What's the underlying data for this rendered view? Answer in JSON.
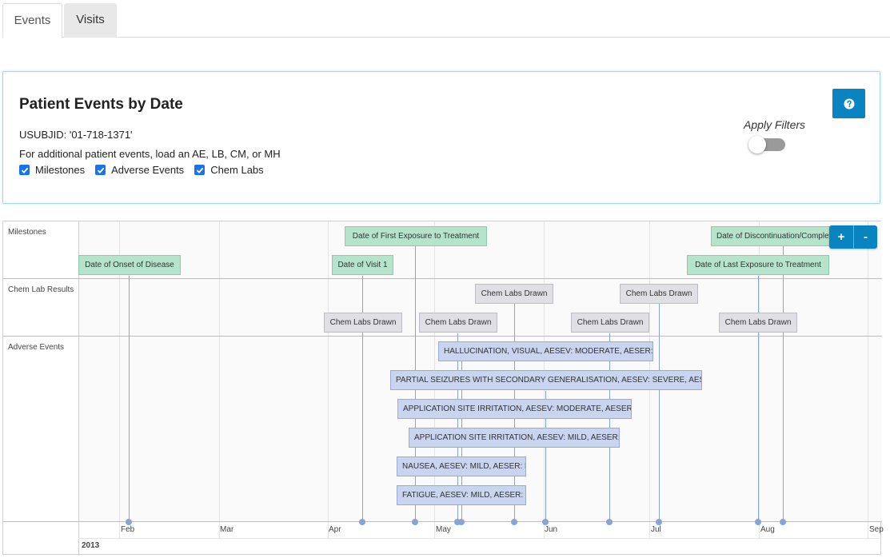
{
  "tabs": [
    {
      "label": "Events",
      "active": true
    },
    {
      "label": "Visits",
      "active": false
    }
  ],
  "card": {
    "title": "Patient Events by Date",
    "subject": "USUBJID: '01-718-1371'",
    "hint": "For additional patient events, load an AE, LB, CM, or MH",
    "checkboxes": [
      {
        "label": "Milestones",
        "checked": true
      },
      {
        "label": "Adverse Events",
        "checked": true
      },
      {
        "label": "Chem Labs",
        "checked": true
      }
    ],
    "apply_filters_label": "Apply Filters",
    "apply_filters_on": false,
    "help_icon": "question-circle-icon"
  },
  "timeline": {
    "row_labels": [
      "Milestones",
      "Chem Lab Results",
      "Adverse Events"
    ],
    "months": [
      "Feb",
      "Mar",
      "Apr",
      "May",
      "Jun",
      "Jul",
      "Aug",
      "Sep"
    ],
    "year": "2013",
    "zoom_in_label": "+",
    "zoom_out_label": "-",
    "milestones": [
      {
        "label": "Date of Onset of Disease"
      },
      {
        "label": "Date of First Exposure to Treatment"
      },
      {
        "label": "Date of Visit 1"
      },
      {
        "label": "Date of Discontinuation/Completion"
      },
      {
        "label": "Date of Last Exposure to Treatment"
      }
    ],
    "labs": [
      {
        "label": "Chem Labs Drawn"
      },
      {
        "label": "Chem Labs Drawn"
      },
      {
        "label": "Chem Labs Drawn"
      },
      {
        "label": "Chem Labs Drawn"
      },
      {
        "label": "Chem Labs Drawn"
      },
      {
        "label": "Chem Labs Drawn"
      }
    ],
    "adverse_events": [
      {
        "label": "HALLUCINATION, VISUAL, AESEV: MODERATE, AESER: N"
      },
      {
        "label": "PARTIAL SEIZURES WITH SECONDARY GENERALISATION, AESEV: SEVERE, AESER: Y"
      },
      {
        "label": "APPLICATION SITE IRRITATION, AESEV: MODERATE, AESER: N"
      },
      {
        "label": "APPLICATION SITE IRRITATION, AESEV: MILD, AESER: N"
      },
      {
        "label": "NAUSEA, AESEV: MILD, AESER: N"
      },
      {
        "label": "FATIGUE, AESEV: MILD, AESER: N"
      }
    ],
    "colors": {
      "milestone": "#b6e3cc",
      "lab": "#e0dfe4",
      "adverse_event": "#c9d4ee",
      "event_line": "#8aa3d6",
      "button": "#0a84c1"
    }
  }
}
